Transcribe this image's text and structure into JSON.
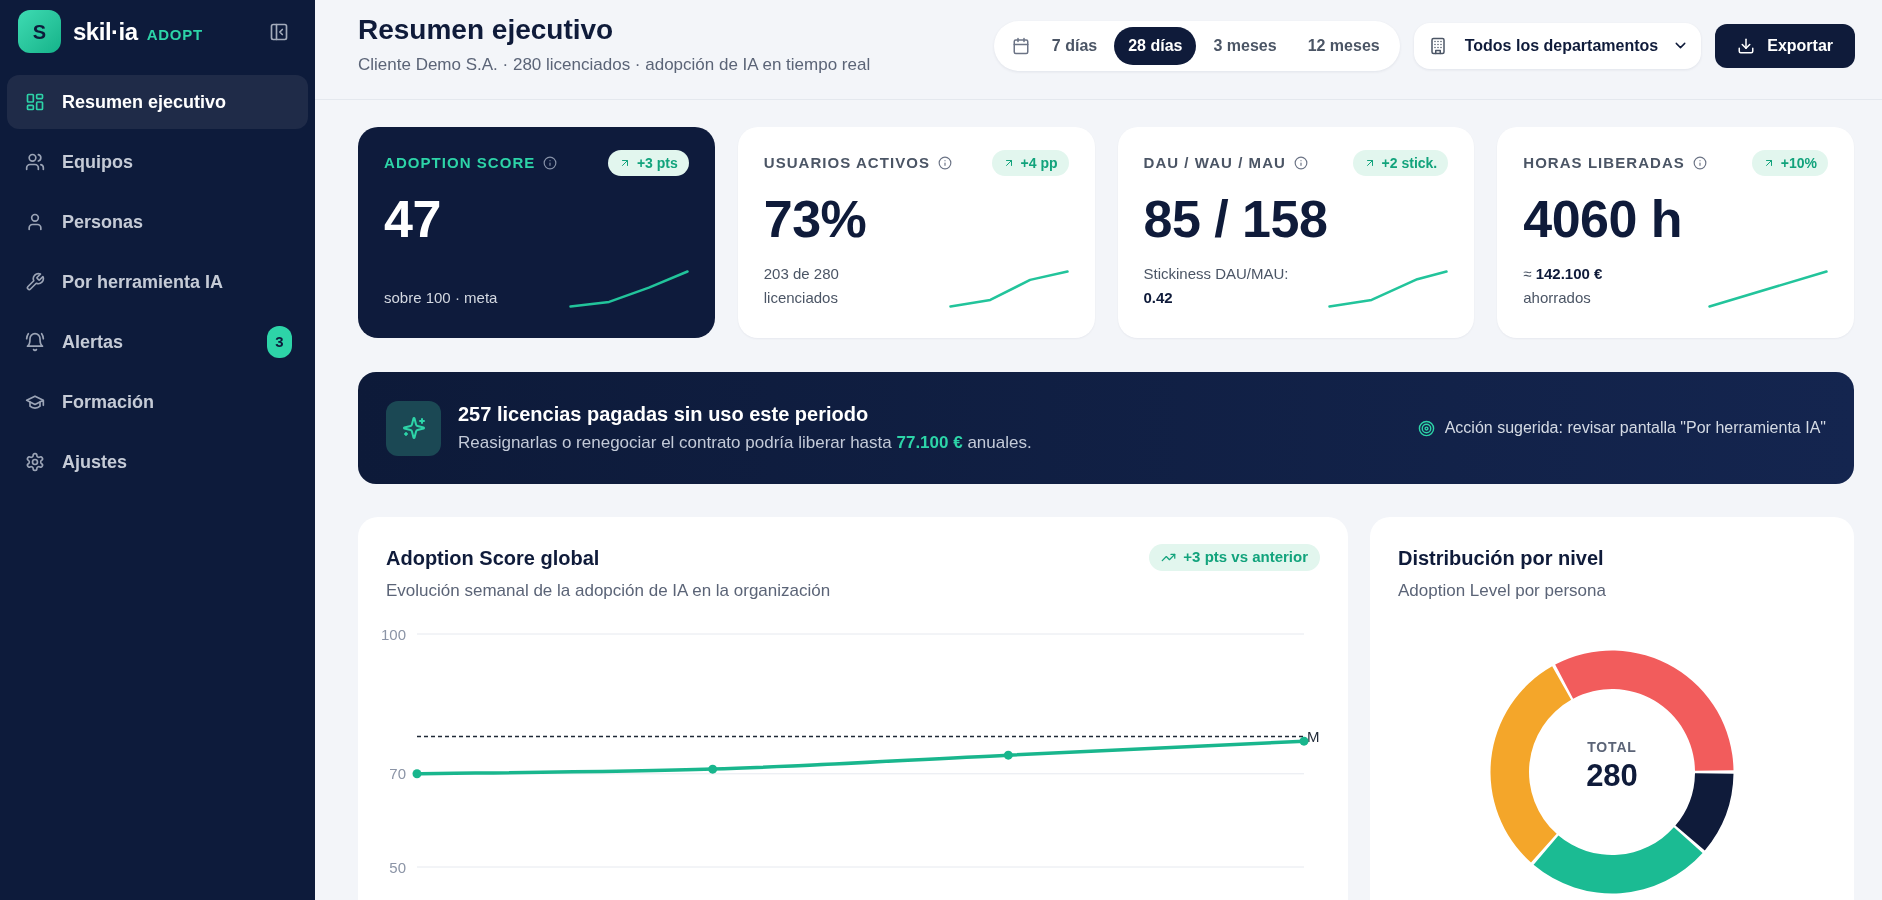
{
  "sidebar": {
    "logo": {
      "initial": "S",
      "name": "skil·ia",
      "tag": "ADOPT"
    },
    "items": [
      {
        "label": "Resumen ejecutivo",
        "selected": true
      },
      {
        "label": "Equipos",
        "selected": false
      },
      {
        "label": "Personas",
        "selected": false
      },
      {
        "label": "Por herramienta IA",
        "selected": false
      },
      {
        "label": "Alertas",
        "selected": false,
        "badge": "3"
      },
      {
        "label": "Formación",
        "selected": false
      },
      {
        "label": "Ajustes",
        "selected": false
      }
    ]
  },
  "header": {
    "title": "Resumen ejecutivo",
    "subtitle": "Cliente Demo S.A. · 280 licenciados · adopción de IA en tiempo real",
    "periods": [
      {
        "label": "7 días",
        "selected": false
      },
      {
        "label": "28 días",
        "selected": true
      },
      {
        "label": "3 meses",
        "selected": false
      },
      {
        "label": "12 meses",
        "selected": false
      }
    ],
    "department": "Todos los departamentos",
    "export": "Exportar"
  },
  "kpis": [
    {
      "kind": "featured",
      "title": "ADOPTION SCORE",
      "change": "+3 pts",
      "value": "47",
      "detail": "sobre 100 · meta"
    },
    {
      "kind": "standard",
      "title": "USUARIOS ACTIVOS",
      "change": "+4 pp",
      "value": "73%",
      "detail": "203 de 280\nlicenciados"
    },
    {
      "kind": "standard",
      "title": "DAU / WAU / MAU",
      "change": "+2 stick.",
      "value": "85 / 158",
      "detail": "Stickiness DAU/MAU:\n**0.42**"
    },
    {
      "kind": "standard",
      "title": "HORAS LIBERADAS",
      "change": "+10%",
      "value": "4060 h",
      "detail": "≈ **142.100 €**\nahorrados"
    }
  ],
  "alert_banner": {
    "title": "257 licencias pagadas sin uso este periodo",
    "text": "Reasignarlas o renegociar el contrato podría liberar hasta **77.100 €** anuales.",
    "action": "Acción sugerida: revisar pantalla \"Por herramienta IA\""
  },
  "score_chart": {
    "title": "Adoption Score global",
    "subtitle": "Evolución semanal de la adopción de IA en la organización",
    "change": "+3 pts vs anterior",
    "chart_data": {
      "type": "line",
      "ylim": [
        50,
        100
      ],
      "yticks": [
        50,
        70,
        100
      ],
      "series": [
        {
          "color": "#19b68d",
          "marker": "circle",
          "values": [
            70,
            71,
            74,
            77
          ]
        }
      ],
      "ref_lines": [
        {
          "axis": "y",
          "value": 78,
          "label": "M"
        }
      ]
    }
  },
  "level_distribution": {
    "title": "Distribución por nivel",
    "subtitle": "Adoption Level por persona",
    "center_label": "TOTAL",
    "center_value": "280"
  }
}
